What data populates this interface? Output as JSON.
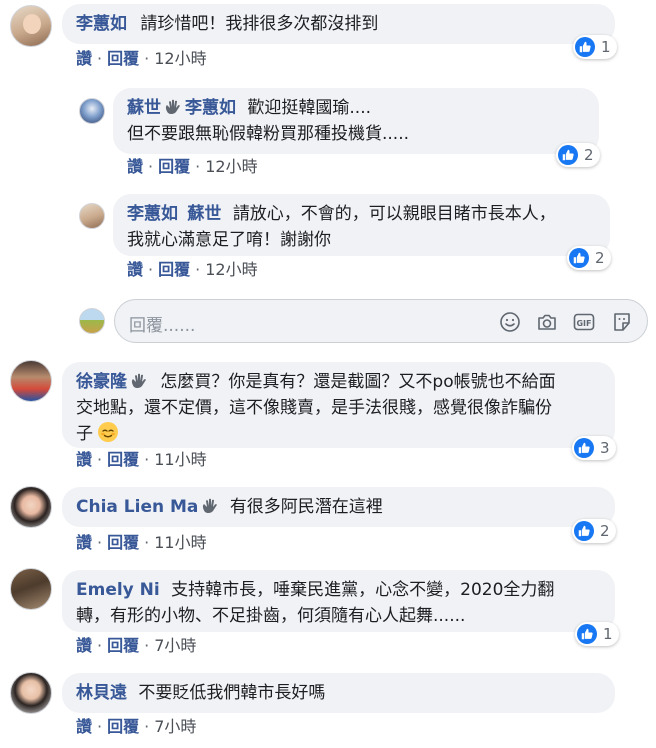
{
  "actions": {
    "like": "讚",
    "reply": "回覆",
    "sep": "·"
  },
  "comments": [
    {
      "author": "李蕙如",
      "text": "請珍惜吧！我排很多次都沒排到",
      "time": "12小時",
      "reactions": "1"
    },
    {
      "author": "蘇世",
      "tag": "李蕙如",
      "line1": "歡迎挺韓國瑜....",
      "line2": "但不要跟無恥假韓粉買那種投機貨.....",
      "time": "12小時",
      "reactions": "2"
    },
    {
      "author": "李蕙如",
      "tag": "蘇世",
      "line1": "請放心，不會的，可以親眼目睹市長本人，",
      "line2": "我就心滿意足了唷！謝謝你",
      "time": "12小時",
      "reactions": "2"
    },
    {
      "author": "徐豪隆",
      "line1": "怎麼買？你是真有？還是截圖？又不po帳號也不給面",
      "line2": "交地點，還不定價，這不像賤賣，是手法很賤，感覺很像詐騙份",
      "line3": "子",
      "time": "11小時",
      "reactions": "3"
    },
    {
      "author": "Chia Lien Ma",
      "text": "有很多阿民潛在這裡",
      "time": "11小時",
      "reactions": "2"
    },
    {
      "author": "Emely Ni",
      "line1": "支持韓市長，唾棄民進黨，心念不變，2020全力翻",
      "line2": "轉，有形的小物、不足掛齒，何須隨有心人起舞......",
      "time": "7小時",
      "reactions": "1"
    },
    {
      "author": "林貝遠",
      "text": "不要貶低我們韓市長好嗎",
      "time": "7小時"
    }
  ],
  "reply_input": {
    "placeholder": "回覆......"
  },
  "colors": {
    "author": "#385898",
    "like": "#1877f2",
    "bubble": "#f0f2f5"
  }
}
